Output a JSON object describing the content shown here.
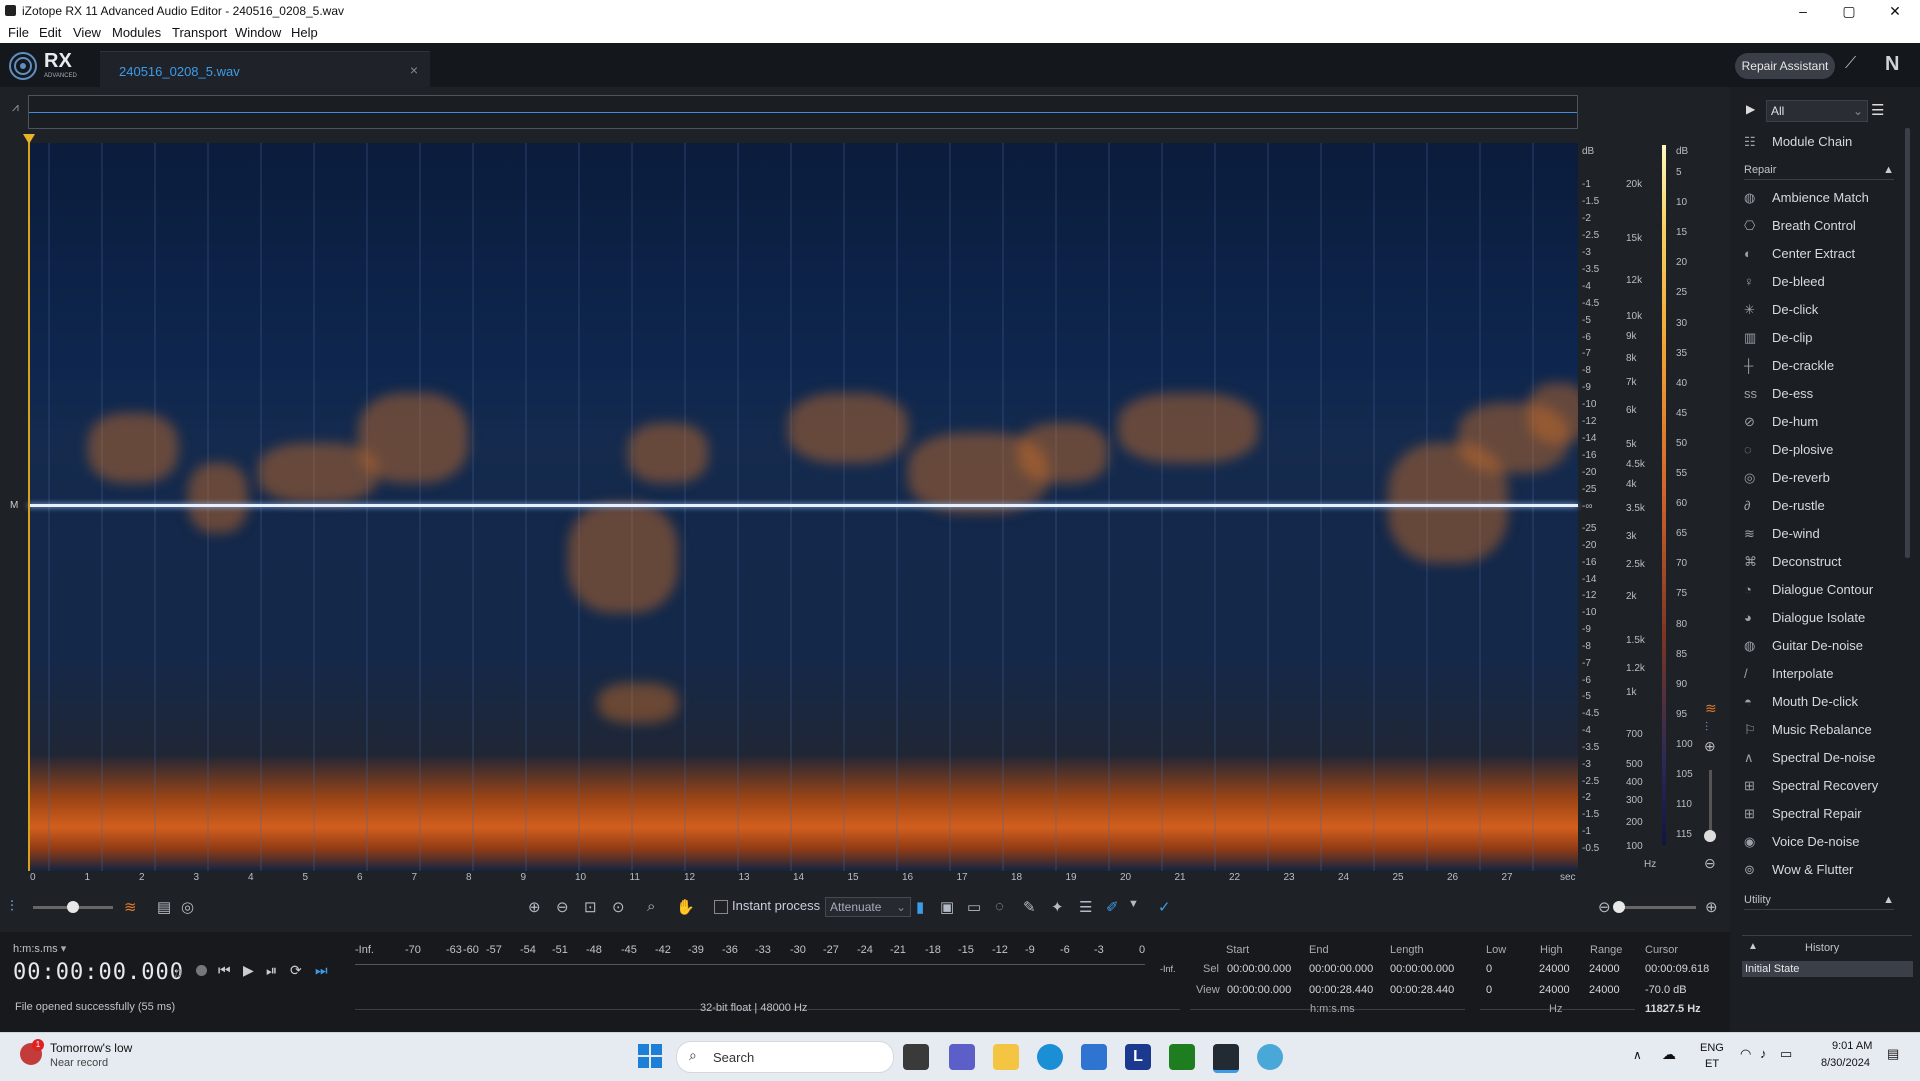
{
  "window": {
    "title": "iZotope RX 11 Advanced Audio Editor - 240516_0208_5.wav",
    "min": "–",
    "max": "▢",
    "close": "✕"
  },
  "menu": [
    "File",
    "Edit",
    "View",
    "Modules",
    "Transport",
    "Window",
    "Help"
  ],
  "header": {
    "logo": "RX",
    "logo_sub": "ADVANCED",
    "file_tab": "240516_0208_5.wav",
    "close_tab": "×",
    "repair_assistant": "Repair Assistant",
    "ni_logo": "N"
  },
  "spectrogram": {
    "channel_label": "M",
    "db_label": "dB",
    "db_ticks_top": [
      "-1",
      "-1.5",
      "-2",
      "-2.5",
      "-3",
      "-3.5",
      "-4",
      "-4.5",
      "-5",
      "-6",
      "-7",
      "-8",
      "-9",
      "-10",
      "-12",
      "-14",
      "-16",
      "-20",
      "-25",
      "-∞"
    ],
    "db_ticks_bottom": [
      "-25",
      "-20",
      "-16",
      "-14",
      "-12",
      "-10",
      "-9",
      "-8",
      "-7",
      "-6",
      "-5",
      "-4.5",
      "-4",
      "-3.5",
      "-3",
      "-2.5",
      "-2",
      "-1.5",
      "-1",
      "-0.5"
    ],
    "hz_ticks": [
      "20k",
      "15k",
      "12k",
      "10k",
      "9k",
      "8k",
      "7k",
      "6k",
      "5k",
      "4.5k",
      "4k",
      "3.5k",
      "3k",
      "2.5k",
      "2k",
      "1.5k",
      "1.2k",
      "1k",
      "700",
      "500",
      "400",
      "300",
      "200",
      "100"
    ],
    "hz_label": "Hz",
    "colorbar_label": "dB",
    "colorbar_ticks": [
      "5",
      "10",
      "15",
      "20",
      "25",
      "30",
      "35",
      "40",
      "45",
      "50",
      "55",
      "60",
      "65",
      "70",
      "75",
      "80",
      "85",
      "90",
      "95",
      "100",
      "105",
      "110",
      "115"
    ],
    "time_ticks": [
      "0",
      "1",
      "2",
      "3",
      "4",
      "5",
      "6",
      "7",
      "8",
      "9",
      "10",
      "11",
      "12",
      "13",
      "14",
      "15",
      "16",
      "17",
      "18",
      "19",
      "20",
      "21",
      "22",
      "23",
      "24",
      "25",
      "26",
      "27"
    ],
    "time_unit": "sec"
  },
  "toolbar": {
    "instant_process": "Instant process",
    "attenuate": "Attenuate"
  },
  "status": {
    "time_format": "h:m:s.ms",
    "timecode": "00:00:00.000",
    "message": "File opened successfully (55 ms)",
    "meter_labels": [
      "-Inf.",
      "-70",
      "-63",
      "-60",
      "-57",
      "-54",
      "-51",
      "-48",
      "-45",
      "-42",
      "-39",
      "-36",
      "-33",
      "-30",
      "-27",
      "-24",
      "-21",
      "-18",
      "-15",
      "-12",
      "-9",
      "-6",
      "-3",
      "0"
    ],
    "meter_right": "-Inf.",
    "format": "32-bit float | 48000 Hz"
  },
  "selection": {
    "headers": {
      "start": "Start",
      "end": "End",
      "length": "Length",
      "low": "Low",
      "high": "High",
      "range": "Range",
      "cursor": "Cursor"
    },
    "sel_label": "Sel",
    "view_label": "View",
    "sel": {
      "start": "00:00:00.000",
      "end": "00:00:00.000",
      "length": "00:00:00.000",
      "low": "0",
      "high": "24000",
      "range": "24000",
      "cursor": "00:00:09.618"
    },
    "view": {
      "start": "00:00:00.000",
      "end": "00:00:28.440",
      "length": "00:00:28.440",
      "low": "0",
      "high": "24000",
      "range": "24000",
      "cursor": "-70.0 dB"
    },
    "time_unit": "h:m:s.ms",
    "freq_unit": "Hz",
    "cursor_freq": "11827.5 Hz"
  },
  "panel": {
    "filter": "All",
    "module_chain": "Module Chain",
    "repair": "Repair",
    "modules": [
      "Ambience Match",
      "Breath Control",
      "Center Extract",
      "De-bleed",
      "De-click",
      "De-clip",
      "De-crackle",
      "De-ess",
      "De-hum",
      "De-plosive",
      "De-reverb",
      "De-rustle",
      "De-wind",
      "Deconstruct",
      "Dialogue Contour",
      "Dialogue Isolate",
      "Guitar De-noise",
      "Interpolate",
      "Mouth De-click",
      "Music Rebalance",
      "Spectral De-noise",
      "Spectral Recovery",
      "Spectral Repair",
      "Voice De-noise",
      "Wow & Flutter"
    ],
    "utility": "Utility",
    "history": "History",
    "initial_state": "Initial State"
  },
  "taskbar": {
    "weather_title": "Tomorrow's low",
    "weather_sub": "Near record",
    "badge": "1",
    "search": "Search",
    "lang1": "ENG",
    "lang2": "ET",
    "time": "9:01 AM",
    "date": "8/30/2024"
  }
}
